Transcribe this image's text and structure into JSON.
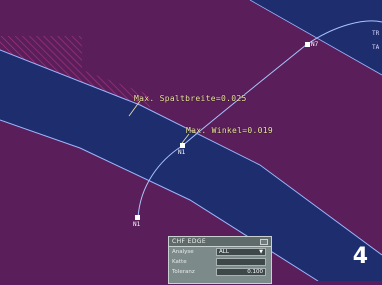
{
  "annotations": {
    "gap_label": "Max. Spaltbreite=0.025",
    "angle_label": "Max. Winkel=0.019"
  },
  "node_labels": {
    "top": "N7",
    "middle": "N1",
    "bottom": "N1"
  },
  "corner_labels": {
    "a": "TR",
    "b": "TA"
  },
  "panel": {
    "title": "CHF EDGE",
    "rows": [
      {
        "label": "Analyse",
        "value": "ALL",
        "type": "dropdown"
      },
      {
        "label": "Katte",
        "value": "",
        "type": "text"
      },
      {
        "label": "Toleranz",
        "value": "0.100",
        "type": "number"
      }
    ]
  },
  "step_number": "4",
  "colors": {
    "background": "#5a1f5a",
    "surface_blue": "#1e2d6e",
    "edge_line": "#9ab6ff",
    "hatch": "#c23a8e",
    "annotation_text": "#f2e6a0"
  }
}
